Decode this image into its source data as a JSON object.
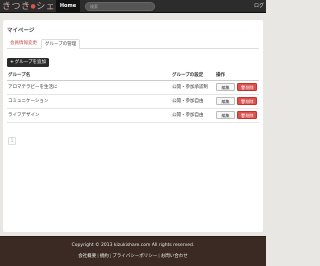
{
  "header": {
    "logo_text": "きつき",
    "logo_suffix": "シェア",
    "home_label": "Home",
    "search_placeholder": "検索",
    "login_label": "ログ"
  },
  "main": {
    "page_title": "マイページ",
    "tabs": [
      {
        "label": "会員情報変更",
        "active": false
      },
      {
        "label": "グループの管理",
        "active": true
      }
    ],
    "add_button_label": "グループを追加",
    "table": {
      "headers": [
        "グループ名",
        "グループの設定",
        "操作"
      ],
      "rows": [
        {
          "name": "アロマテラピーを生活に",
          "setting": "公開・参加承認制"
        },
        {
          "name": "コミュニケーション",
          "setting": "公開・参加自由"
        },
        {
          "name": "ライフデザイン",
          "setting": "公開・参加自由"
        }
      ],
      "edit_label": "編集",
      "delete_label": "削除"
    },
    "pager_label": "1"
  },
  "footer": {
    "copyright": "Copyright © 2013 kizukishare.com All rights reserved.",
    "links": [
      "会社概要",
      "規約",
      "プライバシーポリシー",
      "お問い合わせ"
    ]
  },
  "colors": {
    "accent": "#d9534f",
    "footer_bg": "#3a2a23",
    "topbar_bg": "#2c2c2c"
  }
}
